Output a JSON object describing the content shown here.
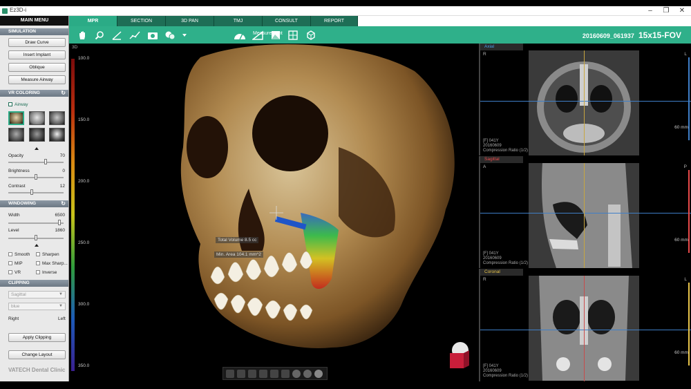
{
  "window": {
    "title": "Ez3D-i",
    "controls": [
      "–",
      "❐",
      "✕"
    ]
  },
  "left_panel": {
    "main_menu": "MAIN MENU",
    "simulation": {
      "header": "SIMULATION",
      "buttons": [
        "Draw Curve",
        "Insert Implant",
        "Oblique",
        "Measure Airway"
      ]
    },
    "vr_coloring": {
      "header": "VR COLORING",
      "airway_label": "Airway",
      "opacity_label": "Opacity",
      "opacity_value": "70",
      "brightness_label": "Brightness",
      "brightness_value": "0",
      "contrast_label": "Contrast",
      "contrast_value": "12"
    },
    "windowing": {
      "header": "WINDOWING",
      "width_label": "Width",
      "width_value": "6500",
      "level_label": "Level",
      "level_value": "1860",
      "options": [
        "Smooth",
        "Sharpen",
        "MIP",
        "Max Sharp...",
        "VR",
        "Inverse"
      ]
    },
    "clipping": {
      "header": "CLIPPING",
      "plane_select": "Sagittal",
      "color_select": "blue",
      "right_label": "Right",
      "left_label": "Left",
      "apply_button": "Apply Clipping"
    },
    "change_layout_button": "Change Layout",
    "brand_text": "VATECH Dental Clinic"
  },
  "tabs": [
    "MPR",
    "SECTION",
    "3D PAN",
    "TMJ",
    "CONSULT",
    "REPORT"
  ],
  "toolbar": {
    "measurement_label": "Measurement",
    "study_id": "20160609_061937",
    "fov_label": "15x15-FOV",
    "tools": [
      "hand-icon",
      "zoom-icon",
      "angle-icon",
      "polyline-icon",
      "camera-icon",
      "capture-icon",
      "sculpt-icon",
      "ruler-angle-icon",
      "image-filter-icon",
      "layout-icon",
      "cube-view-icon"
    ]
  },
  "view3d": {
    "label": "3D",
    "scale_labels": [
      "100.0",
      "150.0",
      "200.0",
      "250.0",
      "300.0",
      "350.0"
    ],
    "total_volume": "Total Volume 8.5 cc",
    "min_area": "Min. Area 104.1 mm^2",
    "bottom_tools": [
      "view-front-icon",
      "view-back-icon",
      "view-left-icon",
      "view-right-icon",
      "view-top-icon",
      "view-bottom-icon",
      "view-skull-1-icon",
      "view-skull-2-icon",
      "view-skull-3-icon"
    ]
  },
  "side_views": [
    {
      "title": "Axial",
      "title_color": "#4a9ee8",
      "left_corner": "R",
      "right_corner": "L",
      "info": [
        "[F] 041Y",
        "20160609",
        "Compression Ratio (1/2)"
      ],
      "scale": "60 mm"
    },
    {
      "title": "Sagittal",
      "title_color": "#e84a4a",
      "left_corner": "A",
      "right_corner": "P",
      "info": [
        "[F] 041Y",
        "20160609",
        "Compression Ratio (1/2)"
      ],
      "scale": "60 mm"
    },
    {
      "title": "Coronal",
      "title_color": "#e8c44a",
      "left_corner": "R",
      "right_corner": "L",
      "info": [
        "[F] 041Y",
        "20160609",
        "Compression Ratio (1/2)"
      ],
      "scale": "60 mm"
    }
  ]
}
